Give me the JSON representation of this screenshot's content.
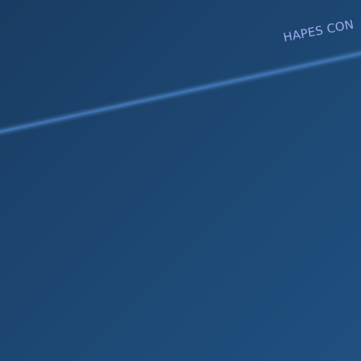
{
  "map": {
    "labels": {
      "region_name": "HAPES CON"
    },
    "colors": {
      "background": "#1c4670",
      "route_line": "#3d72b0",
      "label_text": "#a9b9ff"
    }
  }
}
